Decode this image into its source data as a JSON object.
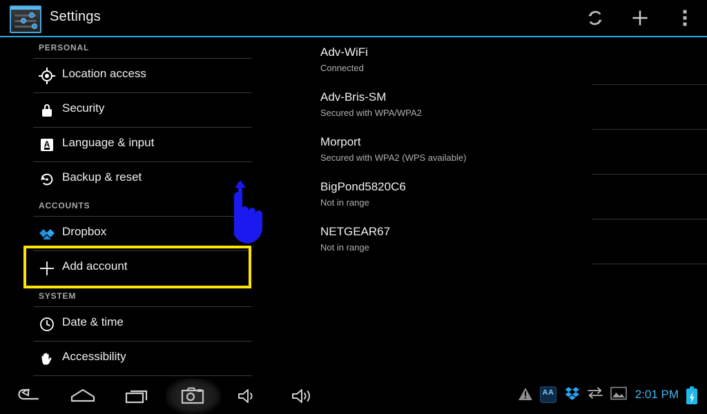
{
  "actionbar": {
    "app_icon_name": "settings-sliders-icon",
    "title": "Settings",
    "sync_label": "sync-icon",
    "add_label": "plus-icon",
    "overflow_label": "overflow-menu-icon",
    "accent_color": "#2aa8e0"
  },
  "sidebar": {
    "sections": [
      {
        "header": "PERSONAL",
        "items": [
          {
            "label": "Location access",
            "icon": "location-crosshair-icon"
          },
          {
            "label": "Security",
            "icon": "padlock-icon"
          },
          {
            "label": "Language & input",
            "icon": "language-a-icon"
          },
          {
            "label": "Backup & reset",
            "icon": "backup-restore-icon"
          }
        ]
      },
      {
        "header": "ACCOUNTS",
        "items": [
          {
            "label": "Dropbox",
            "icon": "dropbox-icon"
          },
          {
            "label": "Add account",
            "icon": "plus-icon"
          }
        ]
      },
      {
        "header": "SYSTEM",
        "items": [
          {
            "label": "Date & time",
            "icon": "clock-icon"
          },
          {
            "label": "Accessibility",
            "icon": "hand-icon"
          }
        ]
      }
    ],
    "highlight": {
      "target_label": "Add account",
      "color": "#ffe400"
    }
  },
  "gesture": {
    "name": "scroll-drag-hand-cursor",
    "color": "#1a1aee"
  },
  "wifi": {
    "networks": [
      {
        "ssid": "Adv-WiFi",
        "status": "Connected",
        "signal": "strong",
        "secured": true
      },
      {
        "ssid": "Adv-Bris-SM",
        "status": "Secured with WPA/WPA2",
        "signal": "strong",
        "secured": true
      },
      {
        "ssid": "Morport",
        "status": "Secured with WPA2 (WPS available)",
        "signal": "weak",
        "secured": true
      },
      {
        "ssid": "BigPond5820C6",
        "status": "Not in range",
        "signal": "none",
        "secured": false
      },
      {
        "ssid": "NETGEAR67",
        "status": "Not in range",
        "signal": "none",
        "secured": false
      }
    ]
  },
  "navbar": {
    "buttons": [
      {
        "name": "back-button",
        "icon": "back-arrow-icon",
        "pressed": false
      },
      {
        "name": "home-button",
        "icon": "home-icon",
        "pressed": false
      },
      {
        "name": "recents-button",
        "icon": "recent-apps-icon",
        "pressed": false
      },
      {
        "name": "screenshot-button",
        "icon": "camera-icon",
        "pressed": true
      },
      {
        "name": "volume-down-button",
        "icon": "volume-down-icon",
        "pressed": false
      },
      {
        "name": "volume-up-button",
        "icon": "volume-up-icon",
        "pressed": false
      }
    ],
    "tray": {
      "warning": "warning-triangle-icon",
      "aa_badge": "AA",
      "dropbox": "dropbox-icon",
      "sync": "sync-arrows-icon",
      "screenshot": "screenshot-icon",
      "clock": "2:01 PM",
      "battery": "battery-charging-icon",
      "clock_color": "#3fb8ee",
      "battery_color": "#1fb8e8"
    }
  }
}
